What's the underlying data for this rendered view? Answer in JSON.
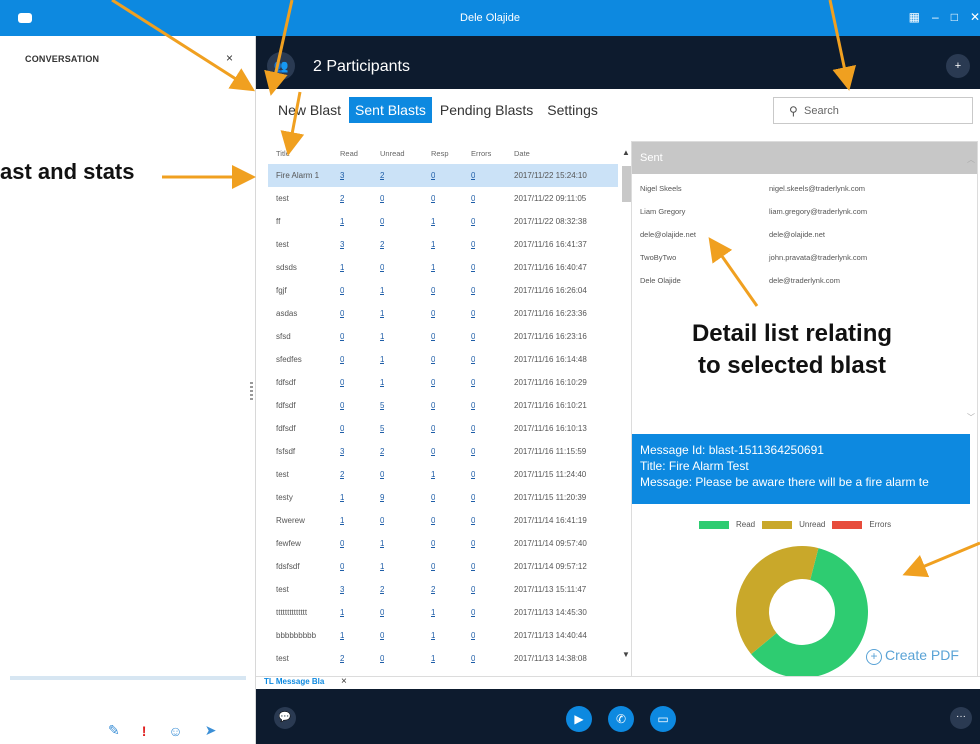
{
  "window": {
    "title": "Dele Olajide",
    "icon": "chat-bubble-icon",
    "controls": [
      "snap-icon",
      "minimize-icon",
      "maximize-icon",
      "close-icon"
    ]
  },
  "sidebar": {
    "heading": "CONVERSATION",
    "close": "×",
    "bottom_icons": [
      "paperclip-icon",
      "priority-icon",
      "emoji-icon",
      "send-icon"
    ]
  },
  "header": {
    "participants": "2 Participants"
  },
  "tabs": [
    {
      "label": "New Blast"
    },
    {
      "label": "Sent Blasts"
    },
    {
      "label": "Pending Blasts"
    },
    {
      "label": "Settings"
    }
  ],
  "search": {
    "placeholder": "Search",
    "icon": "search-icon"
  },
  "table": {
    "columns": [
      "Title",
      "Read",
      "Unread",
      "Resp",
      "Errors",
      "Date"
    ],
    "rows": [
      {
        "title": "Fire Alarm 1",
        "read": "3",
        "unread": "2",
        "resp": "0",
        "errors": "0",
        "date": "2017/11/22 15:24:10"
      },
      {
        "title": "test",
        "read": "2",
        "unread": "0",
        "resp": "0",
        "errors": "0",
        "date": "2017/11/22 09:11:05"
      },
      {
        "title": "ff",
        "read": "1",
        "unread": "0",
        "resp": "1",
        "errors": "0",
        "date": "2017/11/22 08:32:38"
      },
      {
        "title": "test",
        "read": "3",
        "unread": "2",
        "resp": "1",
        "errors": "0",
        "date": "2017/11/16 16:41:37"
      },
      {
        "title": "sdsds",
        "read": "1",
        "unread": "0",
        "resp": "1",
        "errors": "0",
        "date": "2017/11/16 16:40:47"
      },
      {
        "title": "fgjf",
        "read": "0",
        "unread": "1",
        "resp": "0",
        "errors": "0",
        "date": "2017/11/16 16:26:04"
      },
      {
        "title": "asdas",
        "read": "0",
        "unread": "1",
        "resp": "0",
        "errors": "0",
        "date": "2017/11/16 16:23:36"
      },
      {
        "title": "sfsd",
        "read": "0",
        "unread": "1",
        "resp": "0",
        "errors": "0",
        "date": "2017/11/16 16:23:16"
      },
      {
        "title": "sfedfes",
        "read": "0",
        "unread": "1",
        "resp": "0",
        "errors": "0",
        "date": "2017/11/16 16:14:48"
      },
      {
        "title": "fdfsdf",
        "read": "0",
        "unread": "1",
        "resp": "0",
        "errors": "0",
        "date": "2017/11/16 16:10:29"
      },
      {
        "title": "fdfsdf",
        "read": "0",
        "unread": "5",
        "resp": "0",
        "errors": "0",
        "date": "2017/11/16 16:10:21"
      },
      {
        "title": "fdfsdf",
        "read": "0",
        "unread": "5",
        "resp": "0",
        "errors": "0",
        "date": "2017/11/16 16:10:13"
      },
      {
        "title": "fsfsdf",
        "read": "3",
        "unread": "2",
        "resp": "0",
        "errors": "0",
        "date": "2017/11/16 11:15:59"
      },
      {
        "title": "test",
        "read": "2",
        "unread": "0",
        "resp": "1",
        "errors": "0",
        "date": "2017/11/15 11:24:40"
      },
      {
        "title": "testy",
        "read": "1",
        "unread": "9",
        "resp": "0",
        "errors": "0",
        "date": "2017/11/15 11:20:39"
      },
      {
        "title": "Rwerew",
        "read": "1",
        "unread": "0",
        "resp": "0",
        "errors": "0",
        "date": "2017/11/14 16:41:19"
      },
      {
        "title": "fewfew",
        "read": "0",
        "unread": "1",
        "resp": "0",
        "errors": "0",
        "date": "2017/11/14 09:57:40"
      },
      {
        "title": "fdsfsdf",
        "read": "0",
        "unread": "1",
        "resp": "0",
        "errors": "0",
        "date": "2017/11/14 09:57:12"
      },
      {
        "title": "test",
        "read": "3",
        "unread": "2",
        "resp": "2",
        "errors": "0",
        "date": "2017/11/13 15:11:47"
      },
      {
        "title": "tttttttttttttt",
        "read": "1",
        "unread": "0",
        "resp": "1",
        "errors": "0",
        "date": "2017/11/13 14:45:30"
      },
      {
        "title": "bbbbbbbbb",
        "read": "1",
        "unread": "0",
        "resp": "1",
        "errors": "0",
        "date": "2017/11/13 14:40:44"
      },
      {
        "title": "test",
        "read": "2",
        "unread": "0",
        "resp": "1",
        "errors": "0",
        "date": "2017/11/13 14:38:08"
      }
    ]
  },
  "detail": {
    "header": "Sent",
    "rows": [
      {
        "name": "Nigel Skeels",
        "email": "nigel.skeels@traderlynk.com"
      },
      {
        "name": "Liam Gregory",
        "email": "liam.gregory@traderlynk.com"
      },
      {
        "name": "dele@olajide.net",
        "email": "dele@olajide.net"
      },
      {
        "name": "TwoByTwo",
        "email": "john.pravata@traderlynk.com"
      },
      {
        "name": "Dele Olajide",
        "email": "dele@traderlynk.com"
      }
    ]
  },
  "message": {
    "id_line": "Message Id: blast-1511364250691",
    "title_line": "Title: Fire Alarm Test",
    "message_line": "Message: Please be aware there will be a fire alarm te"
  },
  "chart_data": {
    "type": "pie",
    "series": [
      {
        "name": "Read",
        "value": 3,
        "color": "#2ecc71"
      },
      {
        "name": "Unread",
        "value": 2,
        "color": "#c9a82a"
      },
      {
        "name": "Errors",
        "value": 0,
        "color": "#e74c3c"
      }
    ],
    "legend": "top"
  },
  "create_pdf": "Create PDF",
  "bottom_tab": {
    "label": "TL Message Bla",
    "close": "×"
  },
  "bottom_icons": [
    "chat-icon",
    "video-icon",
    "phone-icon",
    "screen-share-icon",
    "more-icon"
  ],
  "annotations": {
    "left": "ast and stats",
    "detail_line1": "Detail list relating",
    "detail_line2": "to selected blast"
  },
  "colors": {
    "accent": "#0d89e0",
    "dark": "#0d1b2e",
    "arrow": "#f0a020"
  }
}
